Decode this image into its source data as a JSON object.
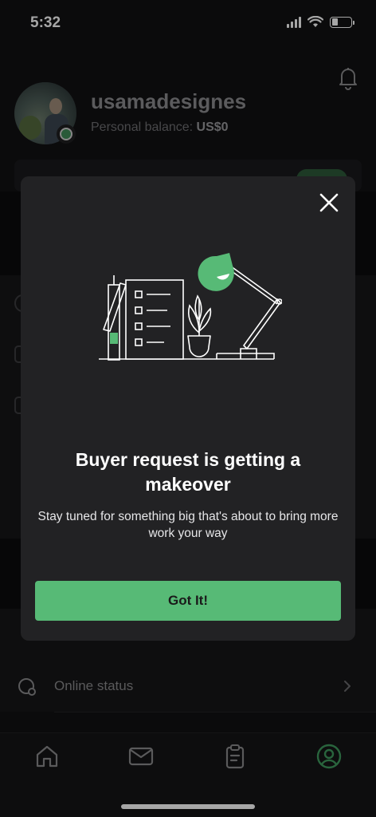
{
  "status_bar": {
    "time": "5:32"
  },
  "profile": {
    "username": "usamadesignes",
    "balance_label": "Personal balance: ",
    "balance_value": "US$0"
  },
  "settings": {
    "online_status_label": "Online status"
  },
  "modal": {
    "title": "Buyer request is getting a makeover",
    "subtitle": "Stay tuned for something big that's about to bring more work your way",
    "button_label": "Got It!"
  },
  "tabbar": {
    "items": [
      {
        "icon": "home-icon",
        "active": false
      },
      {
        "icon": "mail-icon",
        "active": false
      },
      {
        "icon": "orders-clipboard-icon",
        "active": false
      },
      {
        "icon": "profile-icon",
        "active": true
      }
    ]
  },
  "colors": {
    "accent_green": "#57ba76",
    "modal_bg": "#222224",
    "app_bg": "#111113"
  }
}
